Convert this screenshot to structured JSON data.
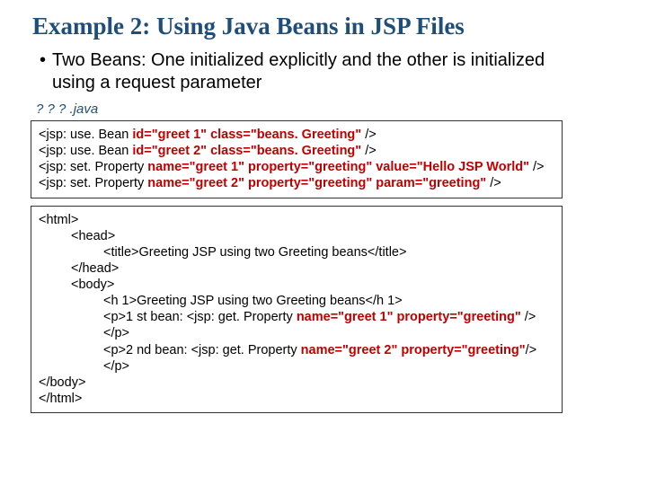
{
  "title": "Example 2: Using Java Beans in JSP Files",
  "bullet": "Two Beans: One initialized explicitly and the other is initialized using a request parameter",
  "filename": "? ? ? .java",
  "box1": {
    "l1a": "<jsp: use. Bean ",
    "l1b": "id=\"greet 1\" class=\"beans. Greeting\"",
    "l1c": " />",
    "l2a": "<jsp: use. Bean ",
    "l2b": "id=\"greet 2\" class=\"beans. Greeting\"",
    "l2c": " />",
    "l3a": "<jsp: set. Property ",
    "l3b": "name=\"greet 1\" property=\"greeting\" value=\"Hello JSP World\"",
    "l3c": " />",
    "l4a": "<jsp: set. Property ",
    "l4b": "name=\"greet 2\" property=\"greeting\" param=\"greeting\"",
    "l4c": " />"
  },
  "box2": {
    "l1": "<html>",
    "l2": "<head>",
    "l3": "<title>Greeting JSP using two Greeting beans</title>",
    "l4": "</head>",
    "l5": "<body>",
    "l6": "<h 1>Greeting JSP using two Greeting beans</h 1>",
    "l7a": "<p>1 st bean:  <jsp: get. Property ",
    "l7b": "name=\"greet 1\"  property=\"greeting\"",
    "l7c": " /> </p>",
    "l8a": "<p>2 nd bean:  <jsp: get. Property ",
    "l8b": "name=\"greet 2\"  property=\"greeting\"",
    "l8c": "/>  </p>",
    "l9": "</body>",
    "l10": "</html>"
  }
}
